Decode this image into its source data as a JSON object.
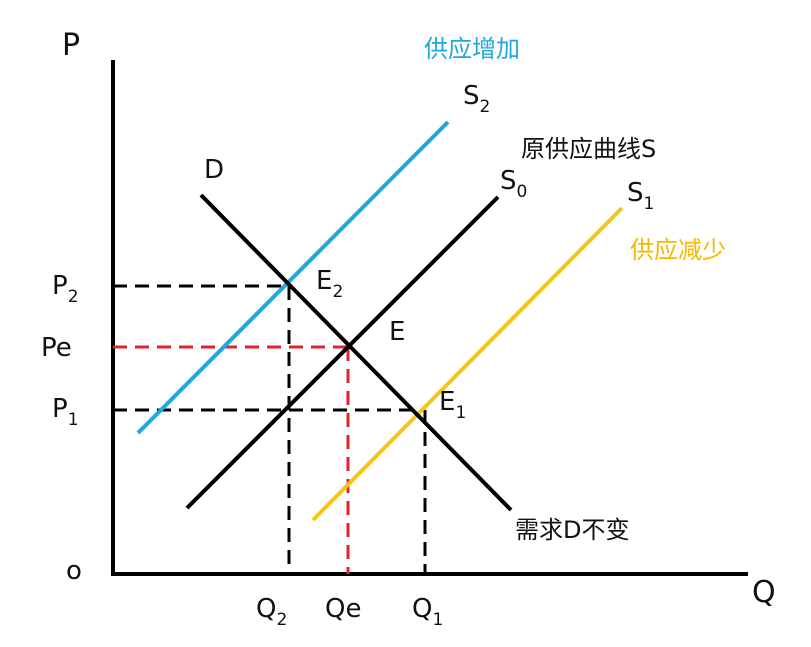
{
  "axes": {
    "y_label": "P",
    "x_label": "Q",
    "origin_label": "o"
  },
  "price_labels": {
    "p2": {
      "main": "P",
      "sub": "2"
    },
    "pe": "Pe",
    "p1": {
      "main": "P",
      "sub": "1"
    }
  },
  "quantity_labels": {
    "q2": {
      "main": "Q",
      "sub": "2"
    },
    "qe": "Qe",
    "q1": {
      "main": "Q",
      "sub": "1"
    }
  },
  "curves": {
    "demand": {
      "label": "D",
      "color": "#000000"
    },
    "s0": {
      "main": "S",
      "sub": "0",
      "color": "#000000"
    },
    "s2": {
      "main": "S",
      "sub": "2",
      "color": "#1ea7e1"
    },
    "s1": {
      "main": "S",
      "sub": "1",
      "color": "#f5c518"
    }
  },
  "points": {
    "e": "E",
    "e2": {
      "main": "E",
      "sub": "2"
    },
    "e1": {
      "main": "E",
      "sub": "1"
    }
  },
  "annotations": {
    "supply_increase": {
      "text": "供应增加",
      "color": "#1ea7e1"
    },
    "original_supply": {
      "text": "原供应曲线S",
      "color": "#111111"
    },
    "supply_decrease": {
      "text": "供应减少",
      "color": "#f5b800"
    },
    "demand_unchanged": {
      "text": "需求D不变",
      "color": "#111111"
    }
  },
  "guide_colors": {
    "equilibrium": "#e0242b",
    "shifted": "#000000"
  }
}
